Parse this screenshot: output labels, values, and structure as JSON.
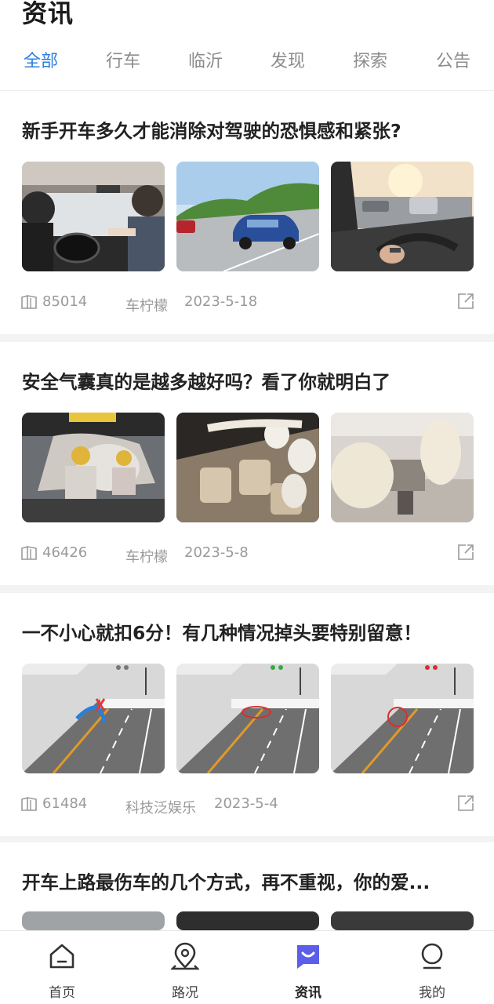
{
  "header": {
    "title": "资讯"
  },
  "tabs": [
    {
      "label": "全部",
      "active": true
    },
    {
      "label": "行车"
    },
    {
      "label": "临沂"
    },
    {
      "label": "发现"
    },
    {
      "label": "探索"
    },
    {
      "label": "公告"
    }
  ],
  "articles": [
    {
      "title": "新手开车多久才能消除对驾驶的恐惧感和紧张?",
      "views": "85014",
      "source": "车柠檬",
      "date": "2023-5-18",
      "images": [
        "car-interior-driving-lesson",
        "blue-suv-on-road",
        "hands-on-steering-wheel"
      ]
    },
    {
      "title": "安全气囊真的是越多越好吗？看了你就明白了",
      "views": "46426",
      "source": "车柠檬",
      "date": "2023-5-8",
      "images": [
        "crash-test-dummies-airbags",
        "deployed-curtain-airbags",
        "deployed-front-airbags"
      ]
    },
    {
      "title": "一不小心就扣6分！有几种情况掉头要特别留意！",
      "views": "61484",
      "source": "科技泛娱乐",
      "date": "2023-5-4",
      "images": [
        "u-turn-diagram-gray-light",
        "u-turn-diagram-green-light",
        "u-turn-diagram-red-light"
      ]
    },
    {
      "title": "开车上路最伤车的几个方式，再不重视，你的爱...",
      "images": [
        "car-photo-1",
        "car-photo-2",
        "car-photo-3"
      ]
    }
  ],
  "tabbar": [
    {
      "label": "首页",
      "icon": "home-icon"
    },
    {
      "label": "路况",
      "icon": "location-pin-icon"
    },
    {
      "label": "资讯",
      "icon": "news-chat-icon",
      "active": true
    },
    {
      "label": "我的",
      "icon": "profile-icon"
    }
  ],
  "colors": {
    "accent": "#2d7fe0",
    "active_tab_icon": "#5b5ee8",
    "muted": "#9a9a9a"
  }
}
